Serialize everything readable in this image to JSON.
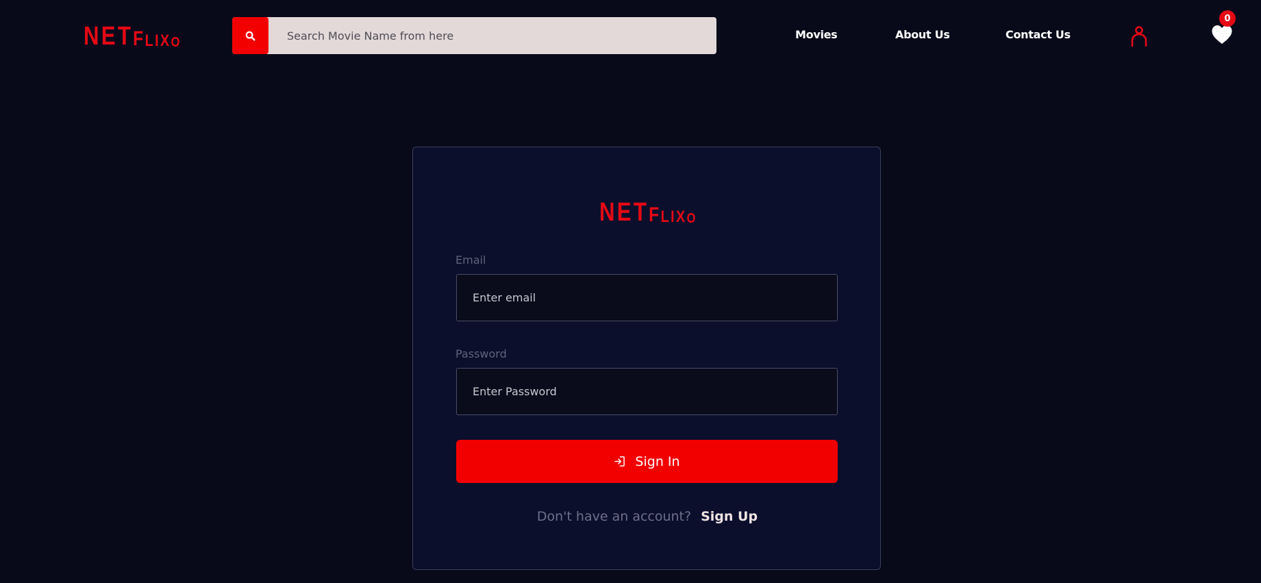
{
  "brand": {
    "logo_part1": "NET",
    "logo_part2": "F",
    "logo_part3": "LIX",
    "logo_part4": "O",
    "color": "#e50914"
  },
  "header": {
    "search": {
      "placeholder": "Search Movie Name from here",
      "button_icon": "search-icon"
    },
    "nav": {
      "movies": "Movies",
      "about": "About Us",
      "contact": "Contact Us"
    },
    "user_icon": "user-icon",
    "favorites": {
      "icon": "heart-icon",
      "count": "0"
    }
  },
  "login": {
    "email_label": "Email",
    "email_placeholder": "Enter email",
    "password_label": "Password",
    "password_placeholder": "Enter Password",
    "signin_icon": "sign-in-icon",
    "signin_label": "Sign In",
    "signup_prompt": "Don't have an account?",
    "signup_link": "Sign Up"
  },
  "colors": {
    "background": "#080a1a",
    "card": "#0b0f2c",
    "accent": "#f20000",
    "search_bg": "#e3d9d9"
  }
}
